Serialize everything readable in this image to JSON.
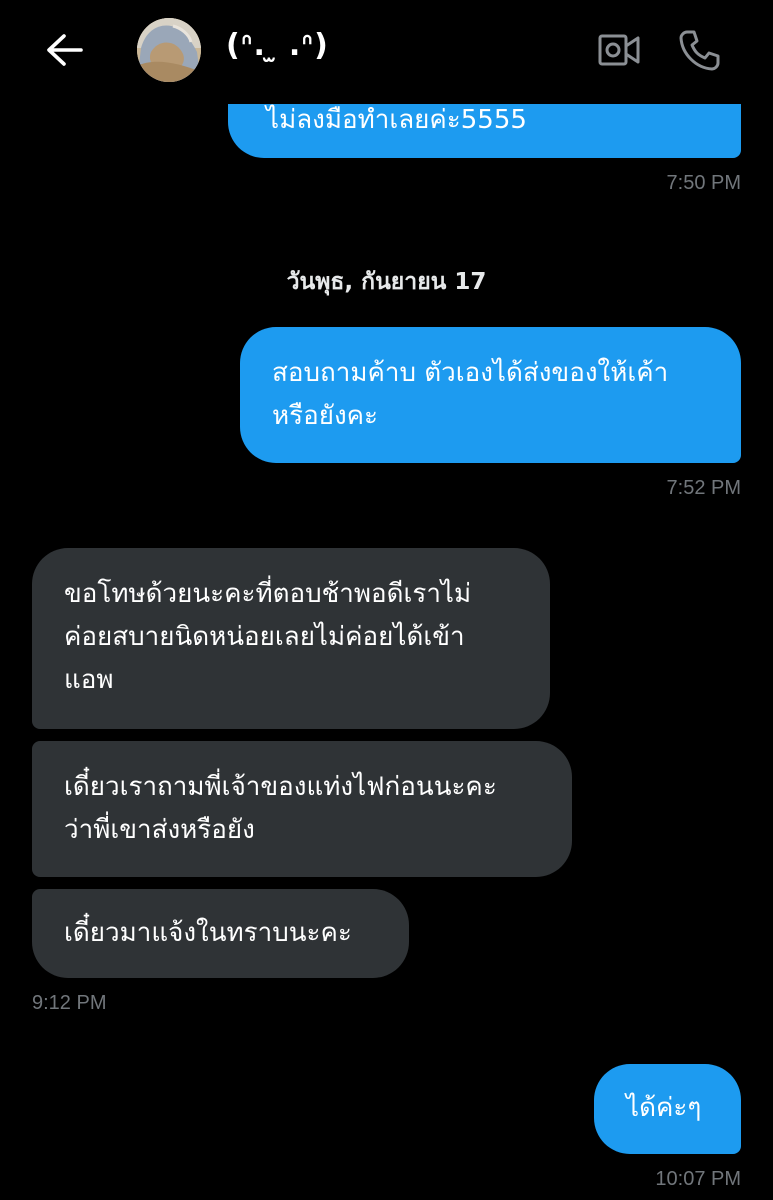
{
  "header": {
    "contact_name": "(ᐢ. ̫ .ᐢ)",
    "back_icon": "arrow-left-icon",
    "video_icon": "video-camera-icon",
    "phone_icon": "phone-icon"
  },
  "colors": {
    "background": "#000000",
    "sent_bubble": "#1d9bf0",
    "received_bubble": "#2f3336",
    "timestamp": "#71767b"
  },
  "messages": {
    "m1": {
      "lines": [
        "ไม่ลงมือทำเลยค่ะ5555"
      ],
      "time": "7:50 PM"
    },
    "date_separator": "วันพุธ, กันยายน 17",
    "m2": {
      "lines": [
        "สอบถามค้าบ ตัวเองได้ส่งของให้เค้า",
        "หรือยังคะ"
      ],
      "time": "7:52 PM"
    },
    "m3": {
      "lines": [
        "ขอโทษด้วยนะคะที่ตอบช้าพอดีเราไม่",
        "ค่อยสบายนิดหน่อยเลยไม่ค่อยได้เข้า",
        "แอพ"
      ]
    },
    "m4": {
      "lines": [
        "เดี๋ยวเราถามพี่เจ้าของแท่งไฟก่อนนะคะ",
        "ว่าพี่เขาส่งหรือยัง"
      ]
    },
    "m5": {
      "lines": [
        "เดี๋ยวมาแจ้งในทราบนะคะ"
      ],
      "time": "9:12 PM"
    },
    "m6": {
      "lines": [
        "ได้ค่ะๆ"
      ],
      "time": "10:07 PM"
    }
  }
}
